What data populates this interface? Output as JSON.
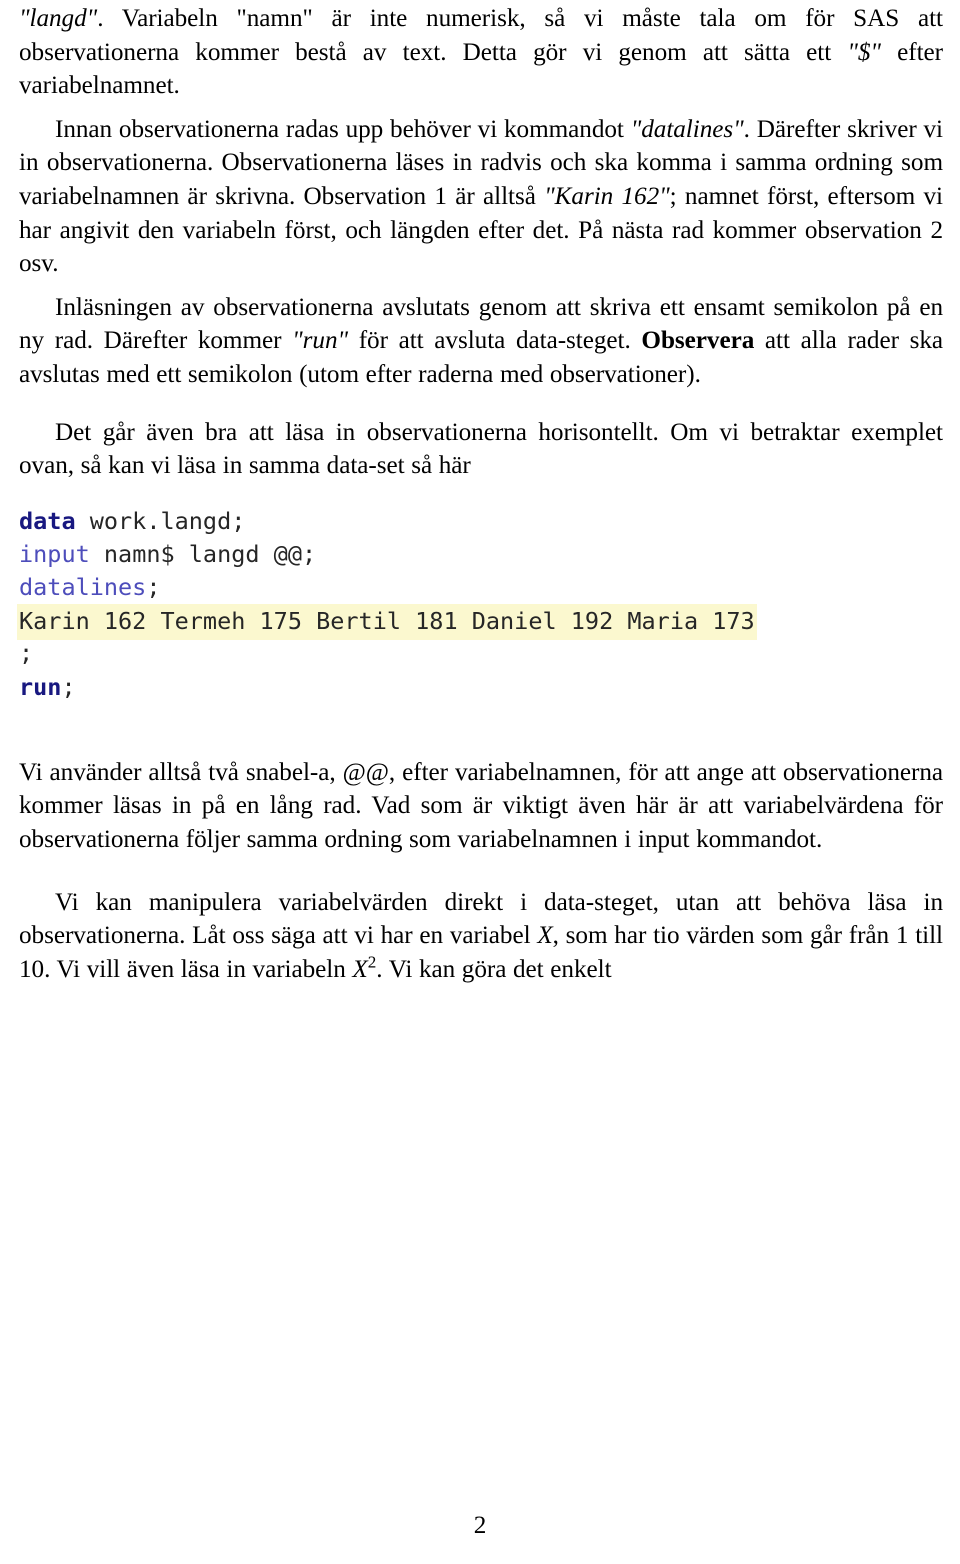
{
  "document": {
    "page_number": "2",
    "language": "sv",
    "colors": {
      "text": "#000000",
      "code_keyword_strong": "#181880",
      "code_keyword_soft": "#4d4dbb",
      "code_plain": "#262626",
      "highlight_background": "#fbf8cf",
      "page_background": "#ffffff"
    }
  },
  "paragraphs": {
    "p1": {
      "seg1_italic": "\"langd\"",
      "seg2": ". Variabeln \"namn\" är inte numerisk, så vi måste tala om för SAS att observationerna kommer bestå av text. Detta gör vi genom att sätta ett ",
      "seg3_italic": "\"$\"",
      "seg4": " efter variabelnamnet."
    },
    "p2": {
      "seg1": "Innan observationerna radas upp behöver vi kommandot ",
      "seg2_italic": "\"datalines\"",
      "seg3": ". Därefter skriver vi in observationerna. Observationerna läses in radvis och ska komma i samma ordning som variabelnamnen är skrivna. Observation 1 är alltså ",
      "seg4_italic": "\"Karin 162\"",
      "seg5": "; namnet först, eftersom vi har angivit den variabeln först, och längden efter det. På nästa rad kommer observation 2 osv."
    },
    "p3": {
      "seg1": "Inläsningen av observationerna avslutats genom att skriva ett ensamt semikolon på en ny rad. Därefter kommer ",
      "seg2_italic": "\"run\"",
      "seg3": " för att avsluta data-steget. ",
      "seg4_bold": "Observera",
      "seg5": " att alla rader ska avslutas med ett semikolon (utom efter raderna med observationer)."
    },
    "p4": {
      "text": "Det går även bra att läsa in observationerna horisontellt. Om vi betraktar exemplet ovan, så kan vi läsa in samma data-set så här"
    },
    "p5": {
      "text": "Vi använder alltså två snabel-a, @@, efter variabelnamnen, för att ange att observationerna kommer läsas in på en lång rad. Vad som är viktigt även här är att variabelvärdena för observationerna följer samma ordning som variabelnamnen i input kommandot."
    },
    "p6": {
      "seg1": "Vi kan manipulera variabelvärden direkt i data-steget, utan att behöva läsa in observationerna. Låt oss säga att vi har en variabel ",
      "seg2_math": "X",
      "seg3": ", som har tio värden som går från 1 till 10. Vi vill även läsa in variabeln ",
      "seg4_math": "X",
      "seg4_math_sup": "2",
      "seg5": ". Vi kan göra det enkelt"
    }
  },
  "code_listing": {
    "lines": [
      {
        "id": "line-data",
        "tokens": [
          {
            "text": "data",
            "style": "kw-strong"
          },
          {
            "text": " work.langd;",
            "style": "plain"
          }
        ]
      },
      {
        "id": "line-input",
        "tokens": [
          {
            "text": "input",
            "style": "kw-soft"
          },
          {
            "text": " namn$ langd @@;",
            "style": "plain"
          }
        ]
      },
      {
        "id": "line-datalines",
        "tokens": [
          {
            "text": "datalines",
            "style": "kw-soft"
          },
          {
            "text": ";",
            "style": "plain"
          }
        ]
      },
      {
        "id": "line-observations",
        "highlighted": true,
        "tokens": [
          {
            "text": "Karin 162 Termeh 175 Bertil 181 Daniel 192 Maria 173",
            "style": "plain"
          }
        ]
      },
      {
        "id": "line-semicolon",
        "tokens": [
          {
            "text": ";",
            "style": "plain"
          }
        ]
      },
      {
        "id": "line-run",
        "tokens": [
          {
            "text": "run",
            "style": "kw-strong"
          },
          {
            "text": ";",
            "style": "plain"
          }
        ]
      }
    ],
    "plain_text": "data work.langd;\ninput namn$ langd @@;\ndatalines;\nKarin 162 Termeh 175 Bertil 181 Daniel 192 Maria 173\n;\nrun;"
  }
}
